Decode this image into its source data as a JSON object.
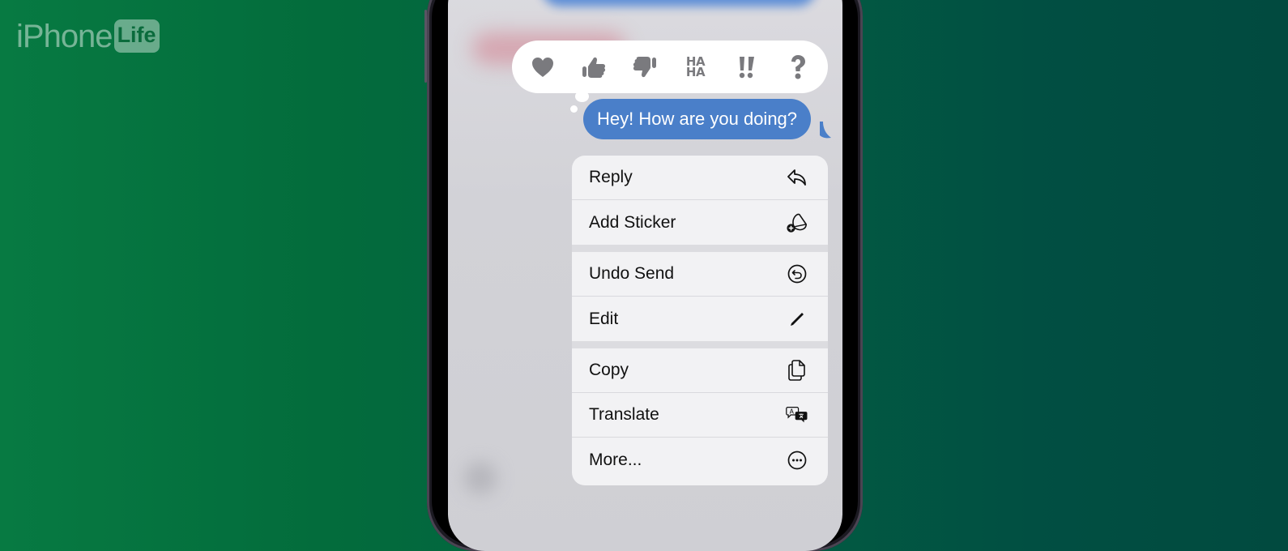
{
  "brand": {
    "logo_main": "iPhone",
    "logo_badge": "Life"
  },
  "colors": {
    "bubble_blue": "#4a7fc9",
    "tapback_icon_gray": "#7a7a7e",
    "menu_background": "#f2f2f4",
    "background_green": "#036c3c"
  },
  "tapbacks": [
    {
      "name": "heart",
      "icon": "heart-icon"
    },
    {
      "name": "thumbs-up",
      "icon": "thumbs-up-icon"
    },
    {
      "name": "thumbs-down",
      "icon": "thumbs-down-icon"
    },
    {
      "name": "haha",
      "icon": "haha-icon",
      "line1": "HA",
      "line2": "HA"
    },
    {
      "name": "emphasize",
      "icon": "double-exclamation-icon"
    },
    {
      "name": "question",
      "icon": "question-mark-icon"
    }
  ],
  "message": {
    "text": "Hey! How are you doing?"
  },
  "menu": {
    "groups": [
      [
        {
          "label": "Reply",
          "icon": "reply-arrow-icon"
        },
        {
          "label": "Add Sticker",
          "icon": "add-sticker-icon"
        }
      ],
      [
        {
          "label": "Undo Send",
          "icon": "undo-circle-icon"
        },
        {
          "label": "Edit",
          "icon": "pencil-icon"
        }
      ],
      [
        {
          "label": "Copy",
          "icon": "copy-documents-icon"
        },
        {
          "label": "Translate",
          "icon": "translate-bubbles-icon"
        },
        {
          "label": "More...",
          "icon": "ellipsis-circle-icon"
        }
      ]
    ]
  }
}
